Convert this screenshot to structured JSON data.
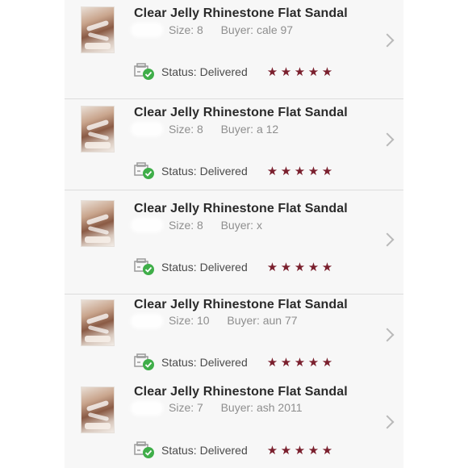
{
  "colors": {
    "star": "#7a1f2d",
    "check": "#3fae49",
    "title": "#2b2b2b",
    "meta": "#8e8e8e"
  },
  "orders": [
    {
      "title": "Clear Jelly Rhinestone Flat Sandal",
      "size_label": "Size:",
      "size": "8",
      "buyer_label": "Buyer:",
      "buyer": "cale  97",
      "status_label": "Status:",
      "status": "Delivered",
      "rating": 5
    },
    {
      "title": "Clear Jelly Rhinestone Flat Sandal",
      "size_label": "Size:",
      "size": "8",
      "buyer_label": "Buyer:",
      "buyer": "a  12",
      "status_label": "Status:",
      "status": "Delivered",
      "rating": 5
    },
    {
      "title": "Clear Jelly Rhinestone Flat Sandal",
      "size_label": "Size:",
      "size": "8",
      "buyer_label": "Buyer:",
      "buyer": "x",
      "status_label": "Status:",
      "status": "Delivered",
      "rating": 5
    },
    {
      "title": "Clear Jelly Rhinestone Flat Sandal",
      "size_label": "Size:",
      "size": "10",
      "buyer_label": "Buyer:",
      "buyer": "aun  77",
      "status_label": "Status:",
      "status": "Delivered",
      "rating": 5
    },
    {
      "title": "Clear Jelly Rhinestone Flat Sandal",
      "size_label": "Size:",
      "size": "7",
      "buyer_label": "Buyer:",
      "buyer": "ash  2011",
      "status_label": "Status:",
      "status": "Delivered",
      "rating": 5
    }
  ],
  "icons": {
    "chevron": "chevron-right-icon",
    "package": "package-delivered-icon",
    "star": "star-icon"
  }
}
